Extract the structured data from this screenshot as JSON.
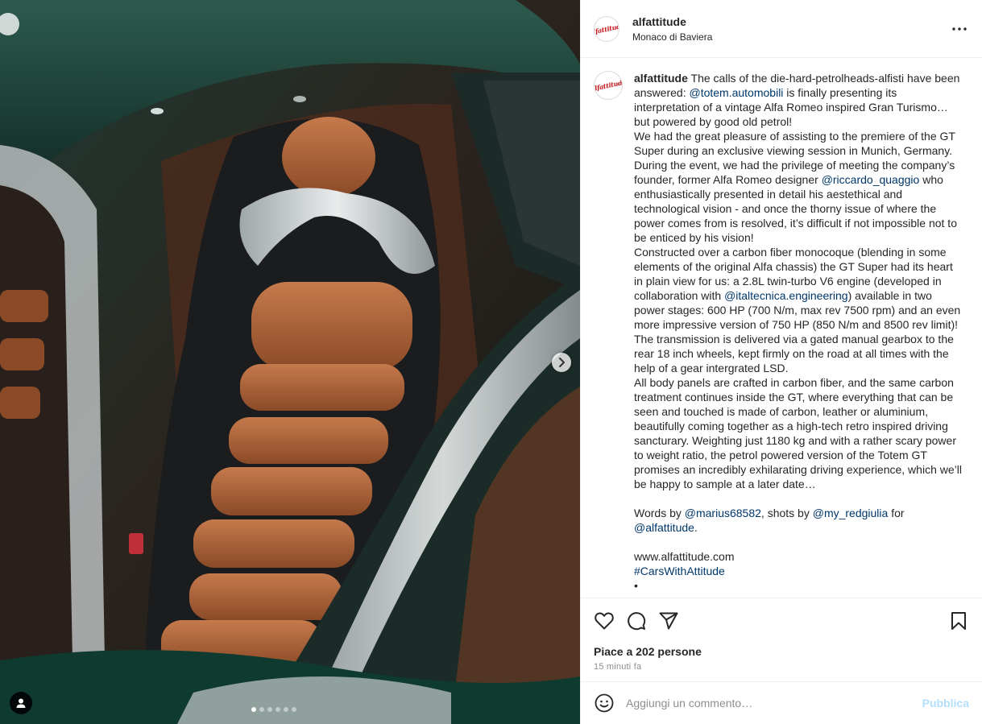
{
  "post": {
    "username": "alfattitude",
    "location": "Monaco di Baviera",
    "avatar_icon": "alfattitude-logo",
    "avatar_text": "Alfattitude"
  },
  "caption": {
    "username": "alfattitude",
    "p1_a": " The calls of the die-hard-petrolheads-alfisti have been answered: ",
    "p1_link": "@totem.automobili",
    "p1_b": " is finally presenting its interpretation of a vintage Alfa Romeo inspired Gran Turismo… but powered by good old petrol!",
    "p2_a": "We had the great pleasure of assisting to the premiere of the GT Super during an exclusive viewing session in Munich, Germany. During the event, we had the privilege of meeting the company’s founder, former Alfa Romeo designer ",
    "p2_link": "@riccardo_quaggio",
    "p2_b": " who enthusiastically presented in detail his aestethical and technological vision - and once the thorny issue of where the power comes from is resolved, it’s difficult if not impossible not to be enticed by his vision!",
    "p3_a": "Constructed over a carbon fiber monocoque (blending in some elements of the original Alfa chassis) the GT Super had its heart in plain view for us: a 2.8L twin-turbo V6 engine (developed in collaboration with ",
    "p3_link": "@italtecnica.engineering",
    "p3_b": ") available in two power stages: 600 HP (700 N/m, max rev 7500 rpm) and an even more impressive version of 750 HP (850 N/m and 8500 rev limit)!",
    "p4": "The transmission is delivered via a gated manual gearbox to the rear 18 inch wheels, kept firmly on the road at all times with the help of a gear intergrated LSD.",
    "p5": "All body panels are crafted in carbon fiber, and the same carbon treatment continues inside the GT, where everything that can be seen and touched is made of carbon, leather or aluminium, beautifully coming together as a high-tech retro inspired driving sancturary. Weighting just 1180 kg and with a rather scary power to weight ratio, the petrol powered version of the Totem GT promises an incredibly exhilarating driving experience, which we’ll be happy to sample at a later date…",
    "credits_a": "Words by ",
    "credits_link1": "@marius68582",
    "credits_b": ", shots by ",
    "credits_link2": "@my_redgiulia",
    "credits_c": " for ",
    "credits_link3": "@alfattitude",
    "credits_d": ".",
    "website": "www.alfattitude.com",
    "hashtag": "#CarsWithAttitude",
    "bullet": "•"
  },
  "actions": {
    "like_icon": "heart-icon",
    "comment_icon": "comment-icon",
    "share_icon": "share-icon",
    "save_icon": "bookmark-icon",
    "likes_text": "Piace a 202 persone",
    "timestamp": "15 minuti fa"
  },
  "comment_box": {
    "placeholder": "Aggiungi un commento…",
    "value": "",
    "publish_label": "Pubblica"
  },
  "media": {
    "carousel_slides": 6,
    "active_slide": 1
  },
  "colors": {
    "link": "#00376b",
    "publish_disabled": "#b2dffc",
    "meta_gray": "#8e8e8e",
    "brand_red": "#c4161c"
  }
}
